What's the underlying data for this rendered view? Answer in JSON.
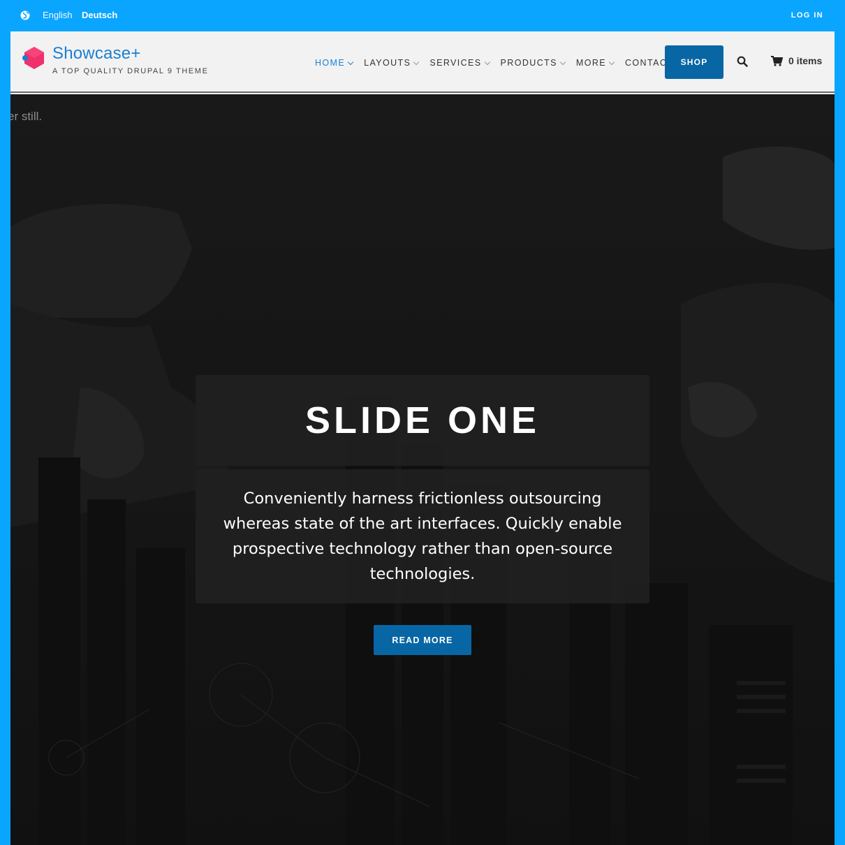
{
  "topbar": {
    "languages": [
      "English",
      "Deutsch"
    ],
    "login_label": "LOG IN",
    "globe_icon": "globe-icon"
  },
  "header": {
    "site_name": "Showcase+",
    "slogan": "A TOP QUALITY DRUPAL 9 THEME",
    "nav": [
      {
        "label": "HOME",
        "has_dropdown": true,
        "active": true
      },
      {
        "label": "LAYOUTS",
        "has_dropdown": true
      },
      {
        "label": "SERVICES",
        "has_dropdown": true
      },
      {
        "label": "PRODUCTS",
        "has_dropdown": true
      },
      {
        "label": "MORE",
        "has_dropdown": true
      },
      {
        "label": "CONTACT",
        "has_dropdown": false
      }
    ],
    "shop_label": "SHOP",
    "search_icon": "search-icon",
    "cart_icon": "cart-icon",
    "cart_label": "0 items"
  },
  "hero": {
    "ghost_text": "er still.",
    "title": "SLIDE ONE",
    "body": "Conveniently harness frictionless outsourcing whereas state of the art interfaces. Quickly enable prospective technology rather than open-source technologies.",
    "button_label": "READ MORE"
  },
  "colors": {
    "accent": "#0aa5ff",
    "brand_blue": "#0866a5",
    "link_blue": "#1a7fd1",
    "logo_pink": "#f0306a"
  }
}
